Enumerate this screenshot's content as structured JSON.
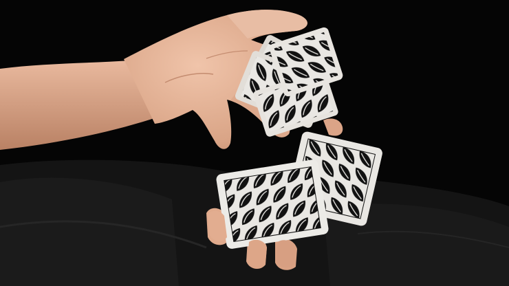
{
  "scene": {
    "subject": "hand-cardistry-flourish",
    "background_color": "#050505",
    "garment_color": "#151515",
    "skin_color": "#e8b79c",
    "card_face_color": "#e9e7e3",
    "card_pattern_color": "#101010",
    "card_count_visible": 4
  }
}
